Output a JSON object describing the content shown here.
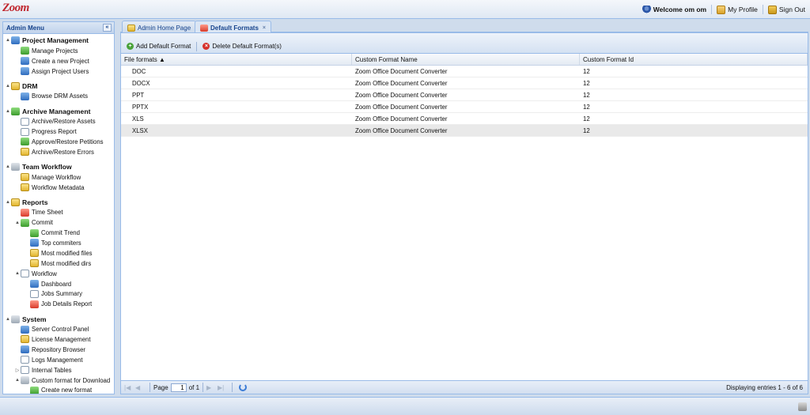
{
  "app": {
    "logo": "Zoom"
  },
  "header": {
    "welcome": "Welcome om om",
    "my_profile": "My Profile",
    "sign_out": "Sign Out"
  },
  "sidebar": {
    "title": "Admin Menu",
    "collapse_icon": "«",
    "rows": [
      {
        "label": "Project Management",
        "level": 0,
        "group": true,
        "icon": "project-icon",
        "color": "c-blue",
        "twisty": "▲"
      },
      {
        "label": "Manage Projects",
        "level": 1,
        "icon": "project-icon",
        "color": "c-green"
      },
      {
        "label": "Create a new Project",
        "level": 1,
        "icon": "globe-add-icon",
        "color": "c-blue"
      },
      {
        "label": "Assign Project Users",
        "level": 1,
        "icon": "users-icon",
        "color": "c-blue"
      },
      {
        "gap": true
      },
      {
        "label": "DRM",
        "level": 0,
        "group": true,
        "icon": "folder-icon",
        "color": "c-yellow",
        "twisty": "▲"
      },
      {
        "label": "Browse DRM Assets",
        "level": 1,
        "icon": "grid-icon",
        "color": "c-blue"
      },
      {
        "gap": true
      },
      {
        "label": "Archive Management",
        "level": 0,
        "group": true,
        "icon": "archive-icon",
        "color": "c-green",
        "twisty": "▲"
      },
      {
        "label": "Archive/Restore Assets",
        "level": 1,
        "icon": "archive-icon",
        "color": "c-doc"
      },
      {
        "label": "Progress Report",
        "level": 1,
        "icon": "report-icon",
        "color": "c-doc"
      },
      {
        "label": "Approve/Restore Petitions",
        "level": 1,
        "icon": "check-shield-icon",
        "color": "c-green"
      },
      {
        "label": "Archive/Restore Errors",
        "level": 1,
        "icon": "error-icon",
        "color": "c-yellow"
      },
      {
        "gap": true
      },
      {
        "label": "Team Workflow",
        "level": 0,
        "group": true,
        "icon": "workflow-icon",
        "color": "c-gray",
        "twisty": "▲"
      },
      {
        "label": "Manage Workflow",
        "level": 1,
        "icon": "workflow-icon",
        "color": "c-yellow"
      },
      {
        "label": "Workflow Metadata",
        "level": 1,
        "icon": "metadata-icon",
        "color": "c-yellow"
      },
      {
        "gap": true
      },
      {
        "label": "Reports",
        "level": 0,
        "group": true,
        "icon": "reports-icon",
        "color": "c-yellow",
        "twisty": "▲"
      },
      {
        "label": "Time Sheet",
        "level": 1,
        "icon": "clock-icon",
        "color": "c-red"
      },
      {
        "label": "Commit",
        "level": 1,
        "icon": "commit-icon",
        "color": "c-green",
        "twisty": "▲"
      },
      {
        "label": "Commit Trend",
        "level": 2,
        "icon": "trend-icon",
        "color": "c-green"
      },
      {
        "label": "Top commiters",
        "level": 2,
        "icon": "user-icon",
        "color": "c-blue"
      },
      {
        "label": "Most modified files",
        "level": 2,
        "icon": "file-icon",
        "color": "c-yellow"
      },
      {
        "label": "Most modified dirs",
        "level": 2,
        "icon": "folder-icon",
        "color": "c-yellow"
      },
      {
        "label": "Workflow",
        "level": 1,
        "icon": "workflow-report-icon",
        "color": "c-doc",
        "twisty": "▲"
      },
      {
        "label": "Dashboard",
        "level": 2,
        "icon": "chart-icon",
        "color": "c-blue"
      },
      {
        "label": "Jobs Summary",
        "level": 2,
        "icon": "document-icon",
        "color": "c-doc"
      },
      {
        "label": "Job Details Report",
        "level": 2,
        "icon": "details-icon",
        "color": "c-red"
      },
      {
        "gap": true
      },
      {
        "label": "System",
        "level": 0,
        "group": true,
        "icon": "computer-icon",
        "color": "c-gray",
        "twisty": "▲"
      },
      {
        "label": "Server Control Panel",
        "level": 1,
        "icon": "monitor-icon",
        "color": "c-blue"
      },
      {
        "label": "License Management",
        "level": 1,
        "icon": "key-icon",
        "color": "c-yellow"
      },
      {
        "label": "Repository Browser",
        "level": 1,
        "icon": "repository-icon",
        "color": "c-blue"
      },
      {
        "label": "Logs Management",
        "level": 1,
        "icon": "logs-icon",
        "color": "c-doc"
      },
      {
        "label": "Internal Tables",
        "level": 1,
        "icon": "table-icon",
        "color": "c-doc",
        "twisty": "▷"
      },
      {
        "label": "Custom format for Download",
        "level": 1,
        "icon": "download-icon",
        "color": "c-gray",
        "twisty": "▲"
      },
      {
        "label": "Create new format",
        "level": 2,
        "icon": "add-icon",
        "color": "c-green"
      }
    ]
  },
  "tabs": [
    {
      "label": "Admin Home Page",
      "icon": "home-icon",
      "active": false
    },
    {
      "label": "Default Formats",
      "icon": "formats-icon",
      "active": true,
      "close": "×"
    }
  ],
  "toolbar": {
    "add_label": "Add Default Format",
    "delete_label": "Delete Default Format(s)",
    "add_glyph": "+",
    "delete_glyph": "×"
  },
  "grid": {
    "headers": [
      "File formats ▲",
      "Custom Format Name",
      "Custom Format Id"
    ],
    "rows": [
      {
        "format": "DOC",
        "name": "Zoom Office Document Converter",
        "id": "12"
      },
      {
        "format": "DOCX",
        "name": "Zoom Office Document Converter",
        "id": "12"
      },
      {
        "format": "PPT",
        "name": "Zoom Office Document Converter",
        "id": "12"
      },
      {
        "format": "PPTX",
        "name": "Zoom Office Document Converter",
        "id": "12"
      },
      {
        "format": "XLS",
        "name": "Zoom Office Document Converter",
        "id": "12"
      },
      {
        "format": "XLSX",
        "name": "Zoom Office Document Converter",
        "id": "12",
        "selected": true
      }
    ]
  },
  "pager": {
    "first": "|◀",
    "prev": "◀",
    "next": "▶",
    "last": "▶|",
    "page_label": "Page",
    "page_value": "1",
    "of_label": "of 1",
    "info": "Displaying entries 1 - 6 of 6"
  }
}
